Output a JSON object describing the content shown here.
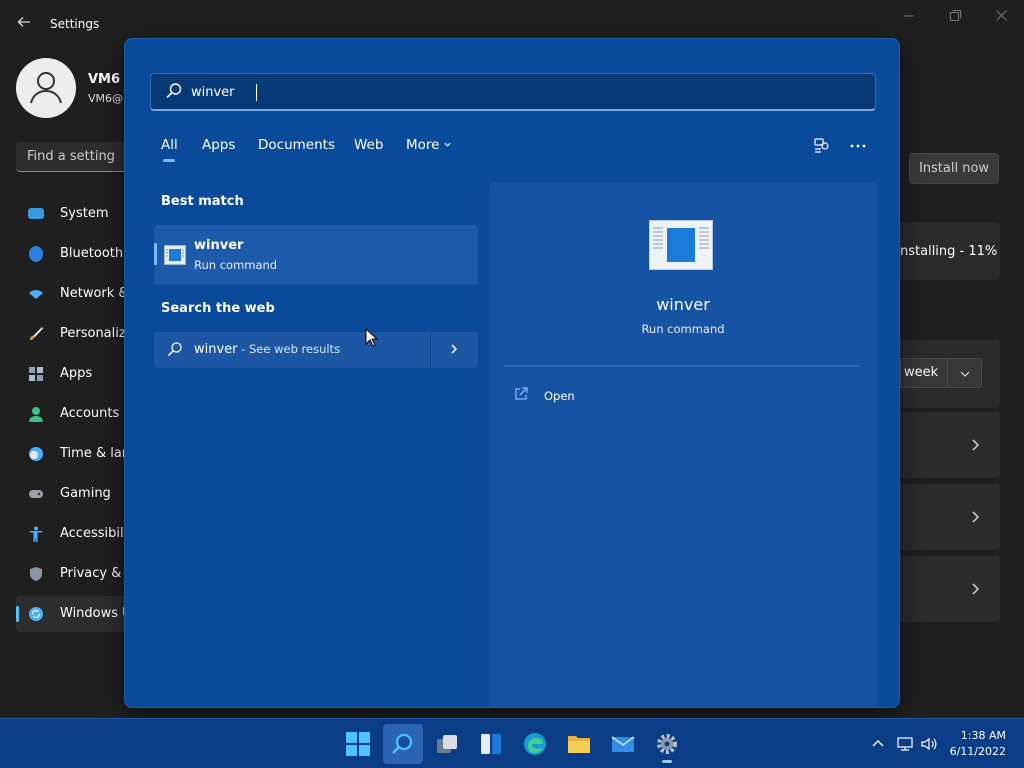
{
  "window": {
    "title": "Settings",
    "back_icon": "arrow-left-icon"
  },
  "profile": {
    "name": "VM6",
    "email": "VM6@"
  },
  "find_setting": {
    "placeholder": "Find a setting"
  },
  "sidebar": {
    "items": [
      {
        "label": "System",
        "icon": "monitor-icon",
        "color": "#3a9be0"
      },
      {
        "label": "Bluetooth",
        "icon": "bluetooth-icon",
        "color": "#2d7fe0"
      },
      {
        "label": "Network &",
        "icon": "wifi-icon",
        "color": "#4cb0ff"
      },
      {
        "label": "Personaliza",
        "icon": "brush-icon",
        "color": "#e8a33c"
      },
      {
        "label": "Apps",
        "icon": "apps-icon",
        "color": "#8aa0b8"
      },
      {
        "label": "Accounts",
        "icon": "person-icon",
        "color": "#3ec08a"
      },
      {
        "label": "Time & lar",
        "icon": "clock-globe-icon",
        "color": "#4cb0ff"
      },
      {
        "label": "Gaming",
        "icon": "gamepad-icon",
        "color": "#9aa0a6"
      },
      {
        "label": "Accessibilit",
        "icon": "accessibility-icon",
        "color": "#4cb0ff"
      },
      {
        "label": "Privacy & s",
        "icon": "shield-icon",
        "color": "#8a96a3"
      },
      {
        "label": "Windows U",
        "icon": "windows-update-icon",
        "color": "#4cb0ff"
      }
    ]
  },
  "main": {
    "install_label": "Install now",
    "installing_label": "nstalling - 11%",
    "week_label": "week"
  },
  "search": {
    "query": "winver",
    "tabs": [
      "All",
      "Apps",
      "Documents",
      "Web",
      "More"
    ],
    "best_match_heading": "Best match",
    "best_match": {
      "title": "winver",
      "subtitle": "Run command"
    },
    "web_heading": "Search the web",
    "web_result": {
      "term": "winver",
      "suffix": " - See web results"
    },
    "detail": {
      "title": "winver",
      "subtitle": "Run command",
      "actions": [
        {
          "label": "Open",
          "icon": "open-external-icon"
        }
      ]
    }
  },
  "taskbar": {
    "time": "1:38 AM",
    "date": "6/11/2022"
  },
  "colors": {
    "flyout_bg": "#0a4a9a",
    "taskbar_bg": "#0b3c86",
    "accent": "#4cc2ff"
  }
}
